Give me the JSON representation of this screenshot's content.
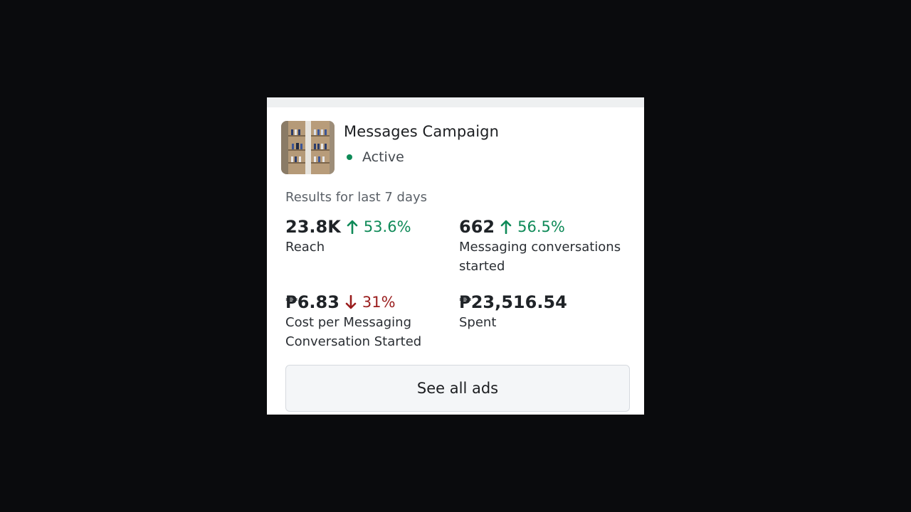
{
  "campaign": {
    "name": "Messages Campaign",
    "status": "Active",
    "status_color": "#0e8a57"
  },
  "results": {
    "period_label": "Results for last 7 days",
    "metrics": [
      {
        "value": "23.8K",
        "delta": "53.6%",
        "direction": "up",
        "label": "Reach"
      },
      {
        "value": "662",
        "delta": "56.5%",
        "direction": "up",
        "label": "Messaging conversations started"
      },
      {
        "value": "₱6.83",
        "delta": "31%",
        "direction": "down",
        "label": "Cost per Messaging Conversation Started"
      },
      {
        "value": "₱23,516.54",
        "delta": "",
        "direction": "none",
        "label": "Spent"
      }
    ]
  },
  "actions": {
    "see_all_label": "See all ads"
  },
  "colors": {
    "up": "#0f8a58",
    "down": "#9a1d1d",
    "background": "#0a0b0d",
    "card": "#ffffff"
  },
  "icons": {
    "up": "arrow-up-icon",
    "down": "arrow-down-icon"
  }
}
